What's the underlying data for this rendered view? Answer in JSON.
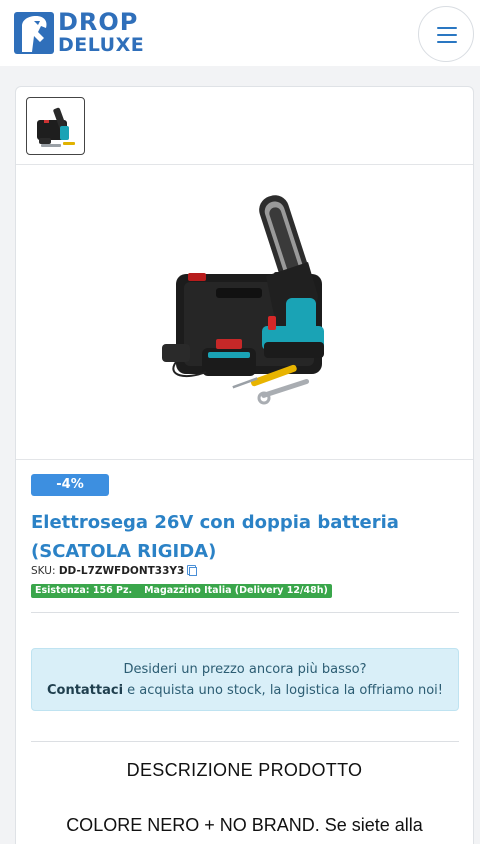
{
  "header": {
    "logo_line1": "DROP",
    "logo_line2": "DELUXE",
    "brand_color": "#2f6fba",
    "menu_icon": "hamburger-icon"
  },
  "product": {
    "discount_badge": "-4%",
    "title": "Elettrosega 26V con doppia batteria (SCATOLA RIGIDA)",
    "sku_label": "SKU:",
    "sku_value": "DD-L7ZWFDONT33Y3",
    "stock_text": "Esistenza: 156 Pz.",
    "warehouse_text": "Magazzino Italia (Delivery 12/48h)"
  },
  "alert": {
    "line1": "Desideri un prezzo ancora più basso?",
    "link_text": "Contattaci",
    "line2_rest": " e acquista uno stock, la logistica la offriamo noi!"
  },
  "description": {
    "heading": "DESCRIZIONE PRODOTTO",
    "text": "COLORE NERO + NO BRAND. Se siete alla"
  },
  "colors": {
    "accent": "#2b82c6",
    "badge": "#3d8fe0",
    "stock": "#3aa64b",
    "alert_bg": "#d9eff8"
  }
}
